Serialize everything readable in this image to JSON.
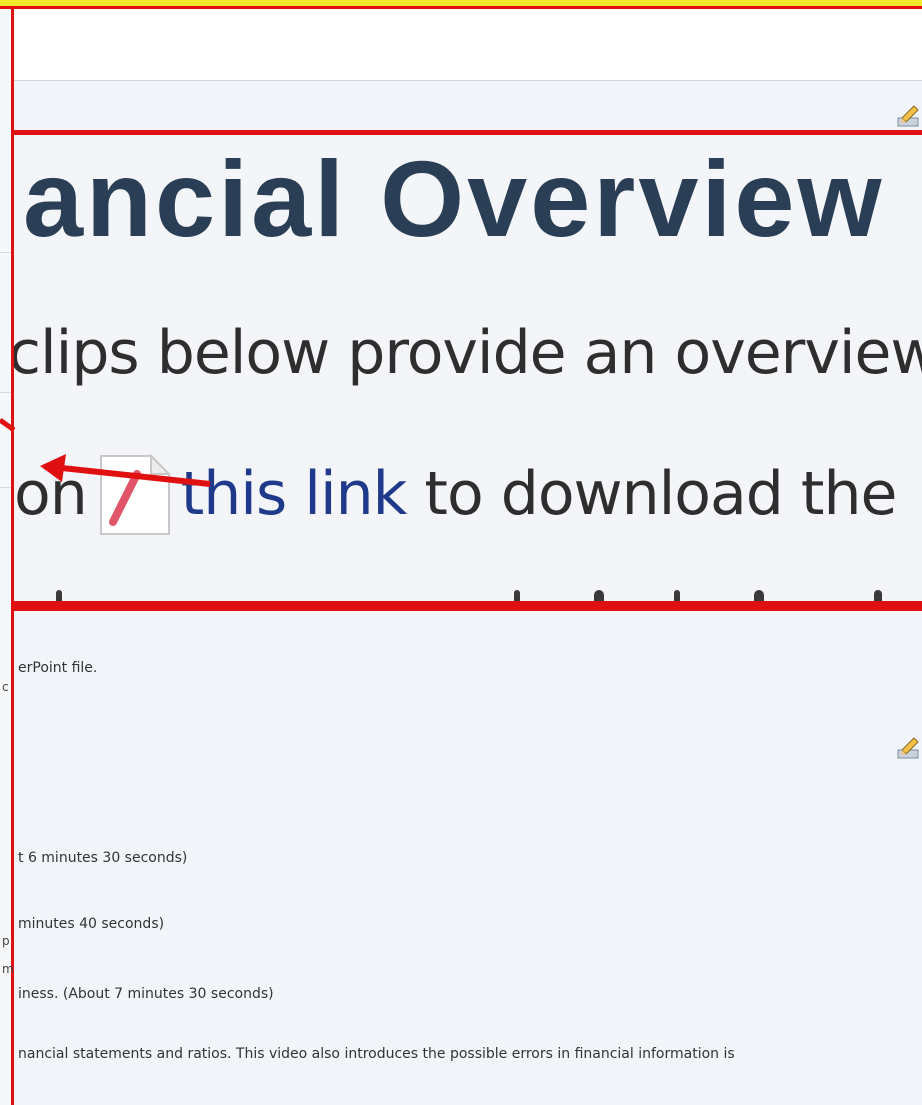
{
  "zoomed": {
    "title": "nancial Overview",
    "line2": "clips below provide an overview",
    "line3_prefix": "on",
    "line3_link": "this link",
    "line3_suffix": "to download the"
  },
  "body_lines": {
    "powerpoint": "erPoint file.",
    "clip1_duration": "t 6 minutes 30 seconds)",
    "clip2_duration": "minutes 40 seconds)",
    "clip3_duration": "iness. (About 7 minutes 30 seconds)",
    "clip4_desc": "nancial statements and ratios. This video also introduces the possible errors in financial information is"
  },
  "left_clipped_chars": [
    "c",
    "p",
    "m"
  ],
  "colors": {
    "annotation_red": "#e01010",
    "highlight_yellow": "#f2ea2a",
    "title_color": "#2a3f55",
    "link_color": "#1f3a8a"
  },
  "icons": {
    "edit": "pencil-edit-icon",
    "file": "powerpoint-file-icon"
  }
}
